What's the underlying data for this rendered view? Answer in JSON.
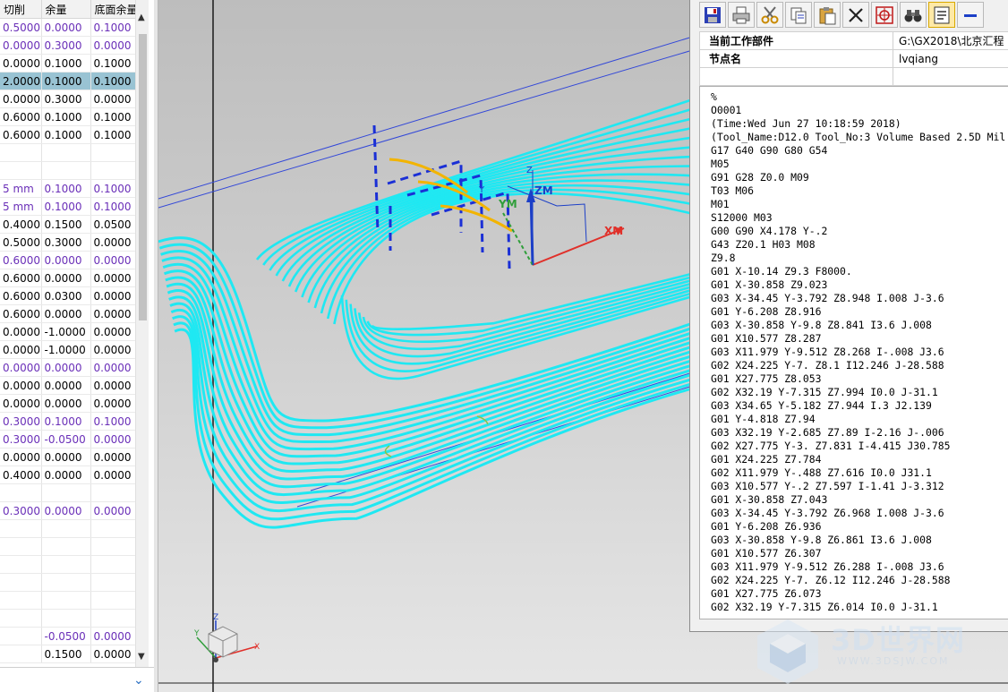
{
  "param_table": {
    "headers": [
      "切削",
      "余量",
      "底面余量"
    ],
    "selected_row": 3,
    "rows": [
      {
        "c": [
          "0.5000",
          "0.0000",
          "0.1000"
        ],
        "purple": true
      },
      {
        "c": [
          "0.0000",
          "0.3000",
          "0.0000"
        ],
        "purple": true
      },
      {
        "c": [
          "0.0000",
          "0.1000",
          "0.1000"
        ],
        "purple": false
      },
      {
        "c": [
          "2.0000",
          "0.1000",
          "0.1000"
        ],
        "purple": false
      },
      {
        "c": [
          "0.0000",
          "0.3000",
          "0.0000"
        ],
        "purple": false
      },
      {
        "c": [
          "0.6000",
          "0.1000",
          "0.1000"
        ],
        "purple": false
      },
      {
        "c": [
          "0.6000",
          "0.1000",
          "0.1000"
        ],
        "purple": false
      },
      {
        "c": [
          "",
          "",
          ""
        ],
        "purple": false
      },
      {
        "c": [
          "",
          "",
          ""
        ],
        "purple": false
      },
      {
        "c": [
          "5 mm",
          "0.1000",
          "0.1000"
        ],
        "purple": true
      },
      {
        "c": [
          "5 mm",
          "0.1000",
          "0.1000"
        ],
        "purple": true
      },
      {
        "c": [
          "0.4000",
          "0.1500",
          "0.0500"
        ],
        "purple": false
      },
      {
        "c": [
          "0.5000",
          "0.3000",
          "0.0000"
        ],
        "purple": false
      },
      {
        "c": [
          "0.6000",
          "0.0000",
          "0.0000"
        ],
        "purple": true
      },
      {
        "c": [
          "0.6000",
          "0.0000",
          "0.0000"
        ],
        "purple": false
      },
      {
        "c": [
          "0.6000",
          "0.0300",
          "0.0000"
        ],
        "purple": false
      },
      {
        "c": [
          "0.6000",
          "0.0000",
          "0.0000"
        ],
        "purple": false
      },
      {
        "c": [
          "0.0000",
          "-1.0000",
          "0.0000"
        ],
        "purple": false
      },
      {
        "c": [
          "0.0000",
          "-1.0000",
          "0.0000"
        ],
        "purple": false
      },
      {
        "c": [
          "0.0000",
          "0.0000",
          "0.0000"
        ],
        "purple": true
      },
      {
        "c": [
          "0.0000",
          "0.0000",
          "0.0000"
        ],
        "purple": false
      },
      {
        "c": [
          "0.0000",
          "0.0000",
          "0.0000"
        ],
        "purple": false
      },
      {
        "c": [
          "0.3000",
          "0.1000",
          "0.1000"
        ],
        "purple": true
      },
      {
        "c": [
          "0.3000",
          "-0.0500",
          "0.0000"
        ],
        "purple": true
      },
      {
        "c": [
          "0.0000",
          "0.0000",
          "0.0000"
        ],
        "purple": false
      },
      {
        "c": [
          "0.4000",
          "0.0000",
          "0.0000"
        ],
        "purple": false
      },
      {
        "c": [
          "",
          "",
          ""
        ],
        "purple": false
      },
      {
        "c": [
          "0.3000",
          "0.0000",
          "0.0000"
        ],
        "purple": true
      },
      {
        "c": [
          "",
          "",
          ""
        ],
        "purple": false
      },
      {
        "c": [
          "",
          "",
          ""
        ],
        "purple": false
      },
      {
        "c": [
          "",
          "",
          ""
        ],
        "purple": false
      },
      {
        "c": [
          "",
          "",
          ""
        ],
        "purple": false
      },
      {
        "c": [
          "",
          "",
          ""
        ],
        "purple": false
      },
      {
        "c": [
          "",
          "",
          ""
        ],
        "purple": false
      },
      {
        "c": [
          "",
          "-0.0500",
          "0.0000"
        ],
        "purple": true
      },
      {
        "c": [
          "",
          "0.1500",
          "0.0000"
        ],
        "purple": false
      }
    ]
  },
  "viewport": {
    "axis_labels": {
      "x": "XM",
      "y": "YM",
      "z": "ZM",
      "z_small": "Z",
      "y_small": "Y"
    },
    "triad": {
      "x": "X",
      "y": "Y",
      "z": "Z"
    }
  },
  "nc_window": {
    "toolbar": [
      {
        "name": "save-icon"
      },
      {
        "name": "print-icon"
      },
      {
        "name": "cut-icon"
      },
      {
        "name": "copy-icon"
      },
      {
        "name": "paste-icon"
      },
      {
        "name": "delete-icon"
      },
      {
        "name": "target-icon"
      },
      {
        "name": "binoculars-icon"
      },
      {
        "name": "wrap-icon",
        "active": true
      },
      {
        "name": "minus-icon"
      }
    ],
    "props": [
      {
        "key": "当前工作部件",
        "value": "G:\\GX2018\\北京汇程"
      },
      {
        "key": "节点名",
        "value": "lvqiang"
      },
      {
        "key": "",
        "value": ""
      }
    ],
    "code": "%\nO0001\n(Time:Wed Jun 27 10:18:59 2018)\n(Tool_Name:D12.0 Tool_No:3 Volume Based 2.5D Mil\nG17 G40 G90 G80 G54\nM05\nG91 G28 Z0.0 M09\nT03 M06\nM01\nS12000 M03\nG00 G90 X4.178 Y-.2\nG43 Z20.1 H03 M08\nZ9.8\nG01 X-10.14 Z9.3 F8000.\nG01 X-30.858 Z9.023\nG03 X-34.45 Y-3.792 Z8.948 I.008 J-3.6\nG01 Y-6.208 Z8.916\nG03 X-30.858 Y-9.8 Z8.841 I3.6 J.008\nG01 X10.577 Z8.287\nG03 X11.979 Y-9.512 Z8.268 I-.008 J3.6\nG02 X24.225 Y-7. Z8.1 I12.246 J-28.588\nG01 X27.775 Z8.053\nG02 X32.19 Y-7.315 Z7.994 I0.0 J-31.1\nG03 X34.65 Y-5.182 Z7.944 I.3 J2.139\nG01 Y-4.818 Z7.94\nG03 X32.19 Y-2.685 Z7.89 I-2.16 J-.006\nG02 X27.775 Y-3. Z7.831 I-4.415 J30.785\nG01 X24.225 Z7.784\nG02 X11.979 Y-.488 Z7.616 I0.0 J31.1\nG03 X10.577 Y-.2 Z7.597 I-1.41 J-3.312\nG01 X-30.858 Z7.043\nG03 X-34.45 Y-3.792 Z6.968 I.008 J-3.6\nG01 Y-6.208 Z6.936\nG03 X-30.858 Y-9.8 Z6.861 I3.6 J.008\nG01 X10.577 Z6.307\nG03 X11.979 Y-9.512 Z6.288 I-.008 J3.6\nG02 X24.225 Y-7. Z6.12 I12.246 J-28.588\nG01 X27.775 Z6.073\nG02 X32.19 Y-7.315 Z6.014 I0.0 J-31.1"
  },
  "watermark": {
    "title": "3D世界网",
    "url": "WWW.3DSJW.COM"
  },
  "colors": {
    "toolpath": "#1fe8f2",
    "selected_row": "#99c3d3",
    "purple_text": "#6a2fb8",
    "axis_x": "#e0302a",
    "axis_z": "#1c3fc7"
  }
}
